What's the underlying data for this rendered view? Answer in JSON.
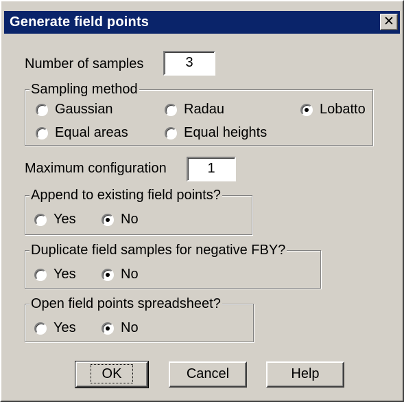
{
  "title": "Generate field points",
  "close_glyph": "✕",
  "samples": {
    "label": "Number of samples",
    "value": "3"
  },
  "sampling": {
    "legend": "Sampling method",
    "options": [
      {
        "label": "Gaussian",
        "selected": false
      },
      {
        "label": "Radau",
        "selected": false
      },
      {
        "label": "Lobatto",
        "selected": true
      },
      {
        "label": "Equal areas",
        "selected": false
      },
      {
        "label": "Equal heights",
        "selected": false
      }
    ]
  },
  "maxconfig": {
    "label": "Maximum configuration",
    "value": "1"
  },
  "append": {
    "legend": "Append to existing field points?",
    "yes": "Yes",
    "no": "No",
    "selected": "No"
  },
  "duplicate": {
    "legend": "Duplicate field samples for negative FBY?",
    "yes": "Yes",
    "no": "No",
    "selected": "No"
  },
  "spreadsheet": {
    "legend": "Open field points spreadsheet?",
    "yes": "Yes",
    "no": "No",
    "selected": "No"
  },
  "buttons": {
    "ok": "OK",
    "cancel": "Cancel",
    "help": "Help"
  }
}
